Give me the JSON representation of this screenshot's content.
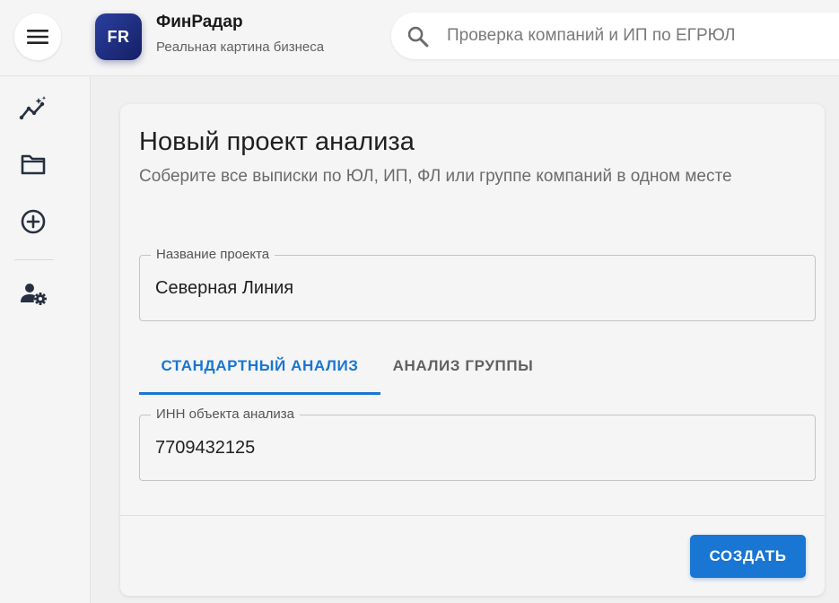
{
  "header": {
    "logo_text": "FR",
    "brand_name": "ФинРадар",
    "brand_tagline": "Реальная картина бизнеса",
    "search_placeholder": "Проверка компаний и ИП по ЕГРЮЛ",
    "search_value": ""
  },
  "sidebar": {
    "items": [
      {
        "icon": "analytics-icon"
      },
      {
        "icon": "folder-icon"
      },
      {
        "icon": "add-circle-icon"
      },
      {
        "icon": "user-settings-icon"
      }
    ]
  },
  "form": {
    "title": "Новый проект анализа",
    "subtitle": "Соберите все выписки по ЮЛ, ИП, ФЛ или группе компаний в одном месте",
    "project_name_label": "Название проекта",
    "project_name_value": "Северная Линия",
    "tabs": [
      {
        "label": "СТАНДАРТНЫЙ АНАЛИЗ",
        "active": true
      },
      {
        "label": "АНАЛИЗ ГРУППЫ",
        "active": false
      }
    ],
    "inn_label": "ИНН объекта анализа",
    "inn_value": "7709432125",
    "submit_label": "СОЗДАТЬ"
  },
  "colors": {
    "accent": "#1976d2",
    "logo_gradient_start": "#2b3f9e",
    "logo_gradient_end": "#141f66",
    "background": "#f0f0f0"
  }
}
